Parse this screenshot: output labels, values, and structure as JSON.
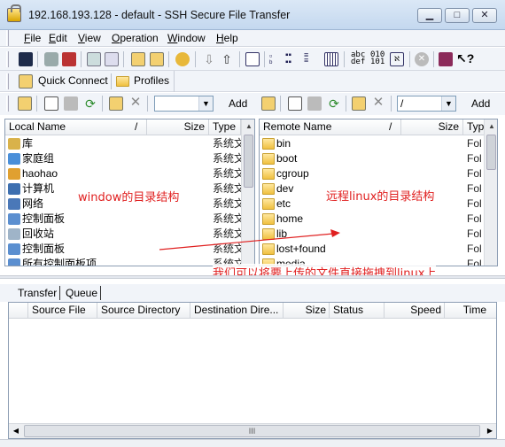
{
  "window": {
    "title": "192.168.193.128 - default - SSH Secure File Transfer",
    "minimize_glyph": "▁",
    "maximize_glyph": "□",
    "close_glyph": "✕"
  },
  "menu": [
    "File",
    "Edit",
    "View",
    "Operation",
    "Window",
    "Help"
  ],
  "menu_accel": [
    "F",
    "E",
    "V",
    "O",
    "W",
    "H"
  ],
  "toolbar": {
    "abc_label": "abc\ndef",
    "binary_label": "010\n101"
  },
  "quick_connect": {
    "label": "Quick Connect",
    "profiles_label": "Profiles"
  },
  "local": {
    "add_label": "Add",
    "combo_value": "",
    "columns": [
      "Local Name",
      "Size",
      "Type"
    ],
    "sort_mark": "/",
    "items": [
      {
        "name": "库",
        "type": "系统文",
        "icon": "library-icon"
      },
      {
        "name": "家庭组",
        "type": "系统文",
        "icon": "homegroup-icon"
      },
      {
        "name": "haohao",
        "type": "系统文",
        "icon": "user-icon"
      },
      {
        "name": "计算机",
        "type": "系统文",
        "icon": "computer-icon"
      },
      {
        "name": "网络",
        "type": "系统文",
        "icon": "network-icon"
      },
      {
        "name": "控制面板",
        "type": "系统文",
        "icon": "control-panel-icon"
      },
      {
        "name": "回收站",
        "type": "系统文",
        "icon": "recycle-bin-icon"
      },
      {
        "name": "控制面板",
        "type": "系统文",
        "icon": "control-panel-icon"
      },
      {
        "name": "所有控制面板项",
        "type": "系统文",
        "icon": "control-panel-icon"
      }
    ]
  },
  "remote": {
    "add_label": "Add",
    "combo_value": "/",
    "columns": [
      "Remote Name",
      "Size",
      "Typ"
    ],
    "sort_mark": "/",
    "items": [
      {
        "name": "bin",
        "type": "Fol"
      },
      {
        "name": "boot",
        "type": "Fol"
      },
      {
        "name": "cgroup",
        "type": "Fol"
      },
      {
        "name": "dev",
        "type": "Fol"
      },
      {
        "name": "etc",
        "type": "Fol"
      },
      {
        "name": "home",
        "type": "Fol"
      },
      {
        "name": "lib",
        "type": "Fol"
      },
      {
        "name": "lost+found",
        "type": "Fol"
      },
      {
        "name": "media",
        "type": "Fol"
      }
    ]
  },
  "annotations": {
    "local": "window的目录结构",
    "remote": "远程linux的目录结构",
    "drag": "我们可以将要上传的文件直接拖拽到linux上"
  },
  "transfer": {
    "tabs": [
      "Transfer",
      "Queue"
    ],
    "columns": [
      "Source File",
      "Source Directory",
      "Destination Dire...",
      "Size",
      "Status",
      "Speed",
      "Time"
    ],
    "scroll_thumb": "III"
  },
  "colors": {
    "annotation": "#e02020",
    "accent": "#2b64c8"
  }
}
